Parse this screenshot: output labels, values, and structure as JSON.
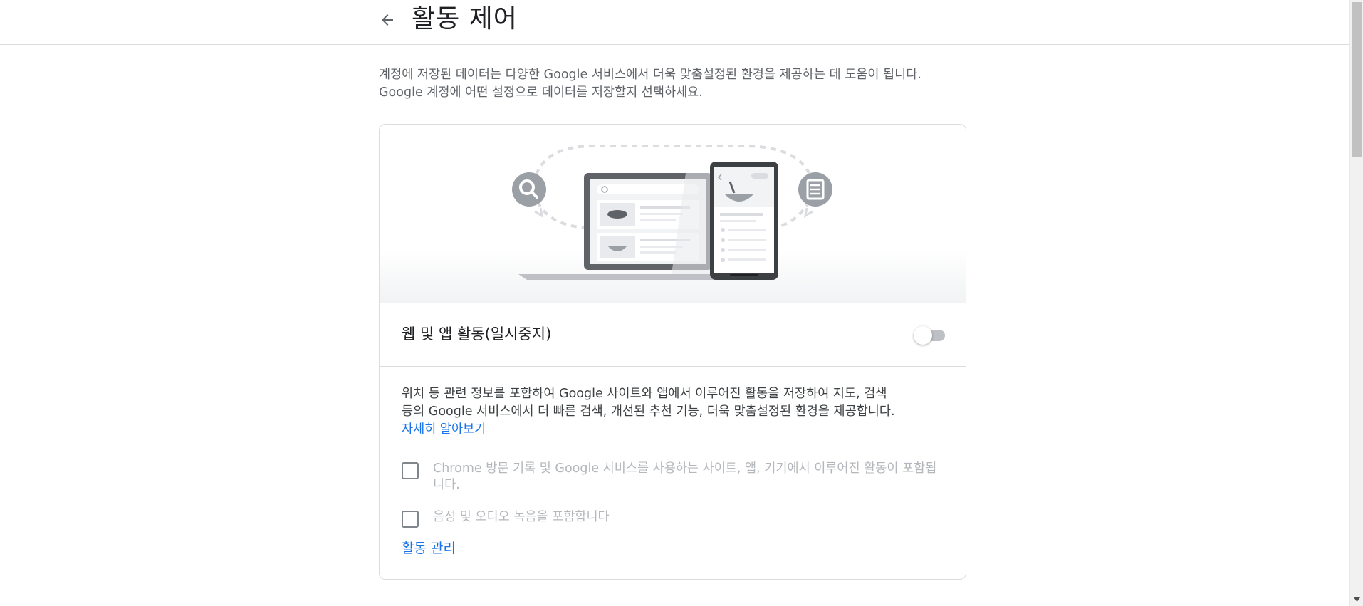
{
  "header": {
    "title": "활동 제어"
  },
  "intro": {
    "line1": "계정에 저장된 데이터는 다양한 Google 서비스에서 더욱 맞춤설정된 환경을 제공하는 데 도움이 됩니다.",
    "line2": "Google 계정에 어떤 설정으로 데이터를 저장할지 선택하세요."
  },
  "card": {
    "toggle_label": "웹 및 앱 활동(일시중지)",
    "toggle_on": false,
    "description": "위치 등 관련 정보를 포함하여 Google 사이트와 앱에서 이루어진 활동을 저장하여 지도, 검색 등의 Google 서비스에서 더 빠른 검색, 개선된 추천 기능, 더욱 맞춤설정된 환경을 제공합니다.",
    "learn_more": "자세히 알아보기",
    "checkboxes": [
      {
        "label": "Chrome 방문 기록 및 Google 서비스를 사용하는 사이트, 앱, 기기에서 이루어진 활동이 포함됩니다.",
        "checked": false
      },
      {
        "label": "음성 및 오디오 녹음을 포함합니다",
        "checked": false
      }
    ],
    "manage_link": "활동 관리"
  },
  "colors": {
    "link": "#1a73e8",
    "border": "#dadce0",
    "disabled_text": "#b4b7bb",
    "toggle_off": "#bdc1c6"
  },
  "icons": {
    "back": "arrow-left-icon",
    "search": "magnifier-icon",
    "document": "document-icon",
    "scroll_down": "triangle-down-icon"
  }
}
